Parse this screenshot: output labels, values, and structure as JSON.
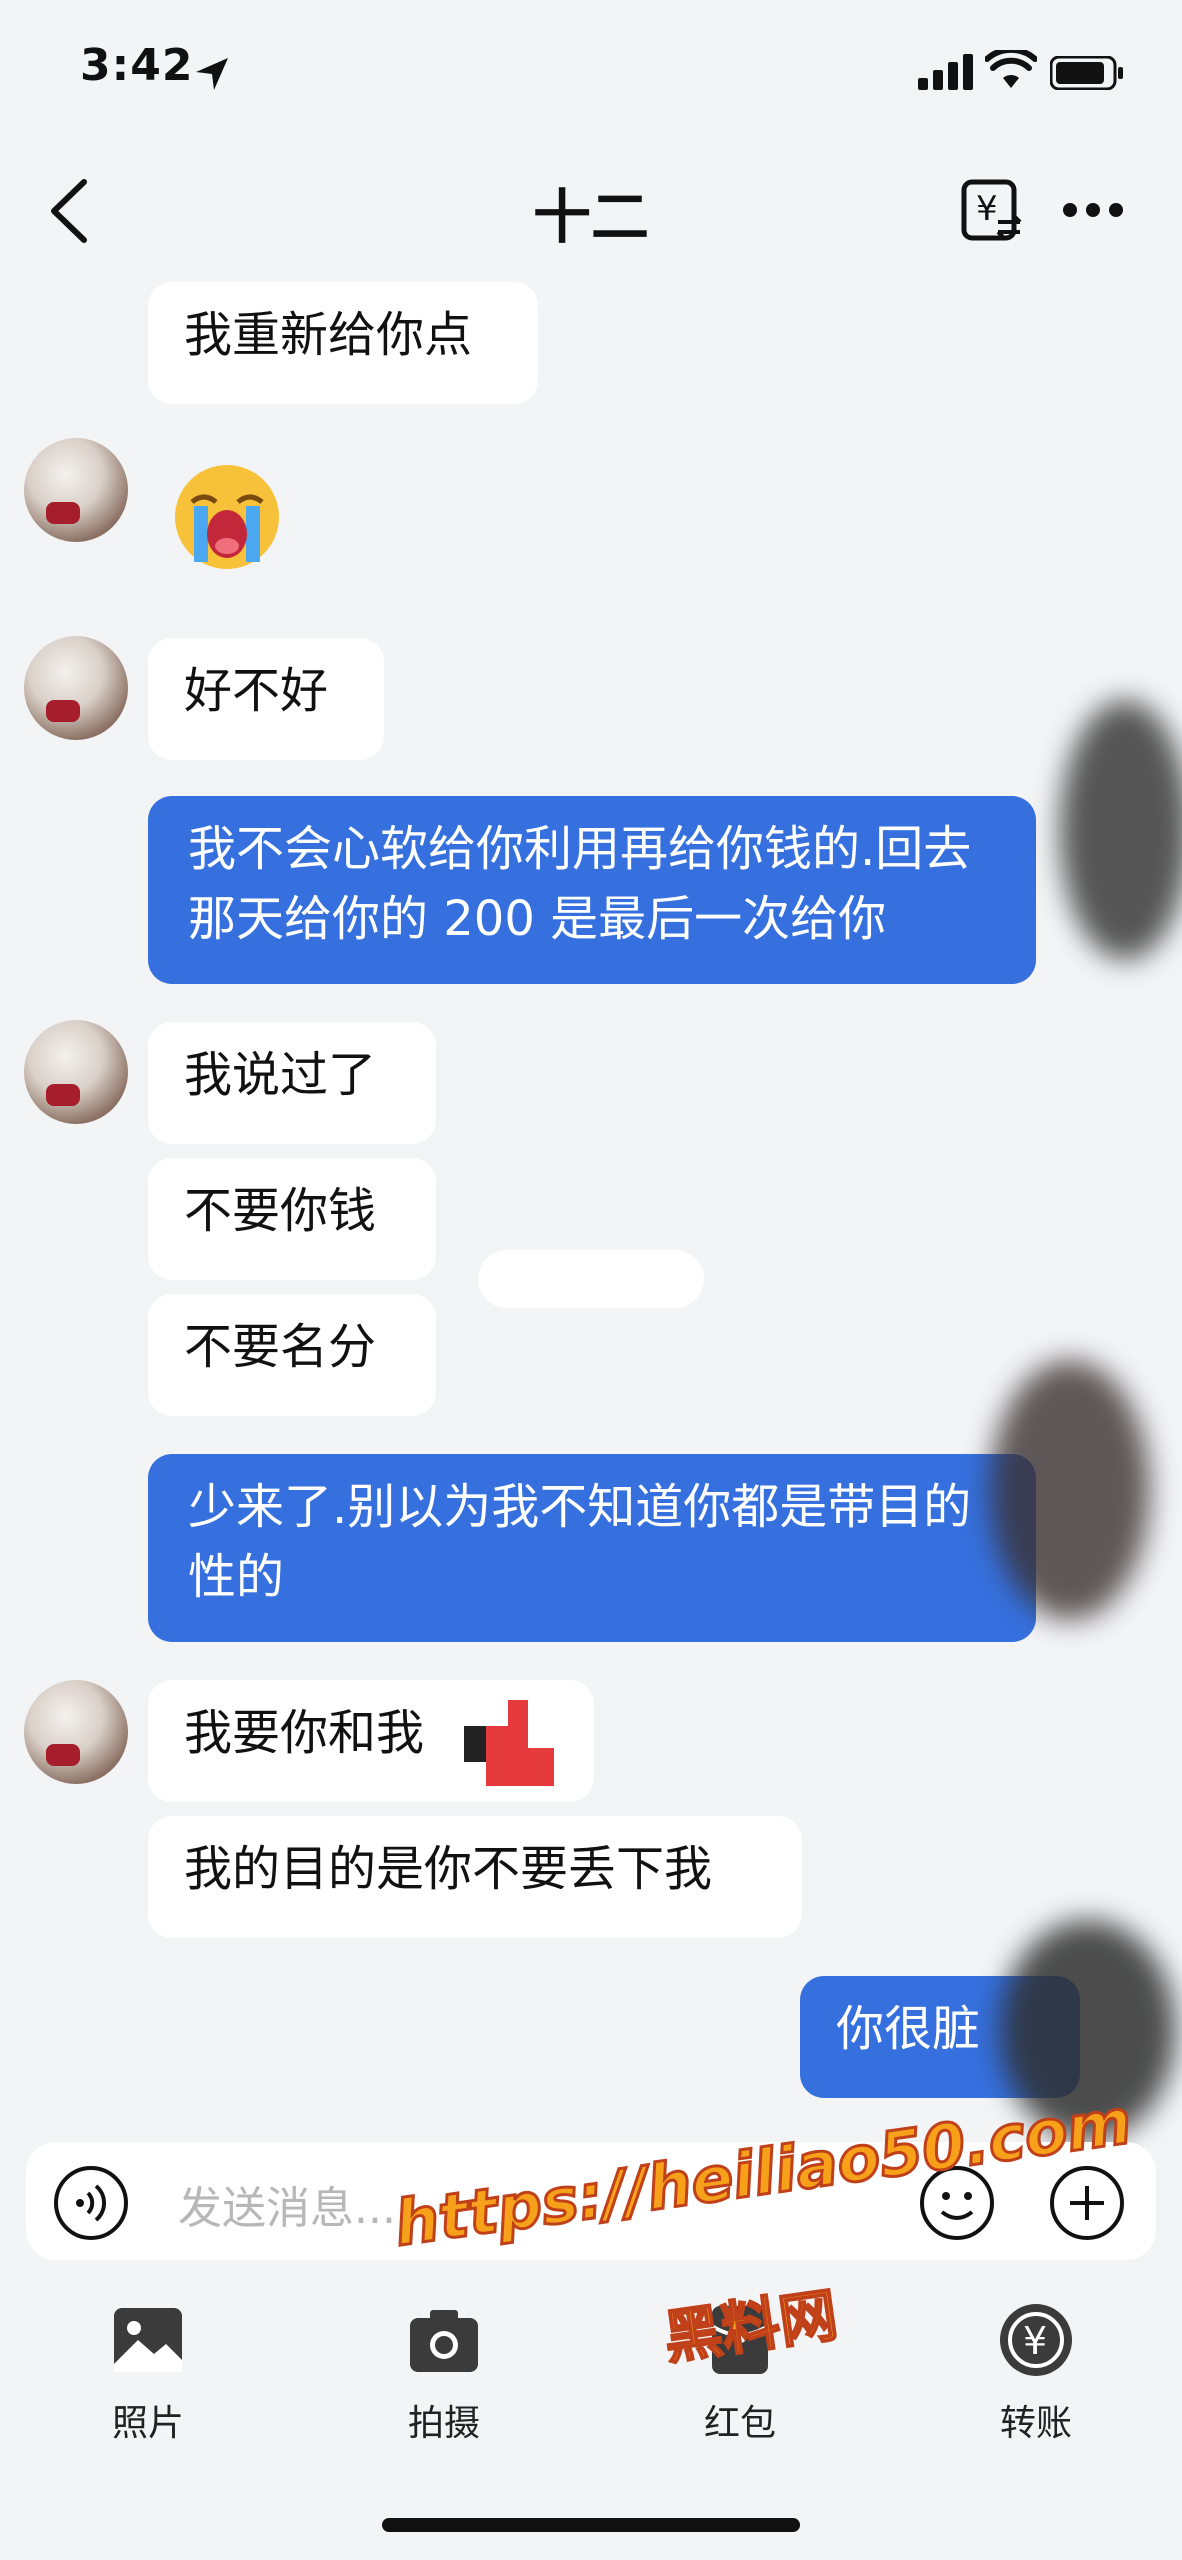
{
  "status": {
    "time": "3:42"
  },
  "header": {
    "title": "十二"
  },
  "messages": [
    {
      "from": "other",
      "text": "我重新给你点"
    },
    {
      "from": "other",
      "text": "好不好"
    },
    {
      "from": "me",
      "text": "我不会心软给你利用再给你钱的.回去那天给你的 200 是最后一次给你"
    },
    {
      "from": "other",
      "text": "我说过了"
    },
    {
      "from": "other",
      "text": "不要你钱"
    },
    {
      "from": "other",
      "text": "不要名分"
    },
    {
      "from": "me",
      "text": "少来了.别以为我不知道你都是带目的性的"
    },
    {
      "from": "other",
      "text": "我要你和我"
    },
    {
      "from": "other",
      "text": "我的目的是你不要丢下我"
    },
    {
      "from": "me",
      "text": "你很脏"
    }
  ],
  "input": {
    "placeholder": "发送消息..."
  },
  "toolbar": [
    {
      "label": "照片",
      "icon": "photo-icon"
    },
    {
      "label": "拍摄",
      "icon": "camera-icon"
    },
    {
      "label": "红包",
      "icon": "red-packet-icon"
    },
    {
      "label": "转账",
      "icon": "transfer-icon"
    }
  ],
  "watermark": {
    "url": "https://heiliao50.com",
    "name": "黑料网"
  },
  "colors": {
    "my_bubble": "#3570de",
    "their_bubble": "#ffffff",
    "background": "#f3f4f6"
  }
}
